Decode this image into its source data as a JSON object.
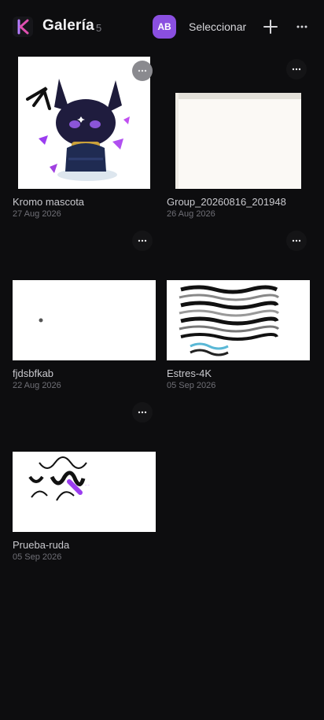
{
  "header": {
    "title": "Galería",
    "count": "5",
    "avatar_initials": "AB",
    "select_label": "Seleccionar"
  },
  "colors": {
    "background": "#0d0d0f",
    "accent": "#8a4fe0",
    "text": "#e8e8ea",
    "muted": "#6f6f76"
  },
  "icons": {
    "logo": "brand-logo-icon",
    "add": "plus-icon",
    "more": "more-horizontal-icon",
    "item_menu": "more-horizontal-icon"
  },
  "gallery": {
    "items": [
      {
        "name": "Kromo mascota",
        "date": "27 Aug 2026"
      },
      {
        "name": "Group_20260816_201948",
        "date": "26 Aug 2026"
      },
      {
        "name": "fjdsbfkab",
        "date": "22 Aug 2026"
      },
      {
        "name": "Estres-4K",
        "date": "05 Sep 2026"
      },
      {
        "name": "Prueba-ruda",
        "date": "05 Sep 2026"
      }
    ]
  }
}
